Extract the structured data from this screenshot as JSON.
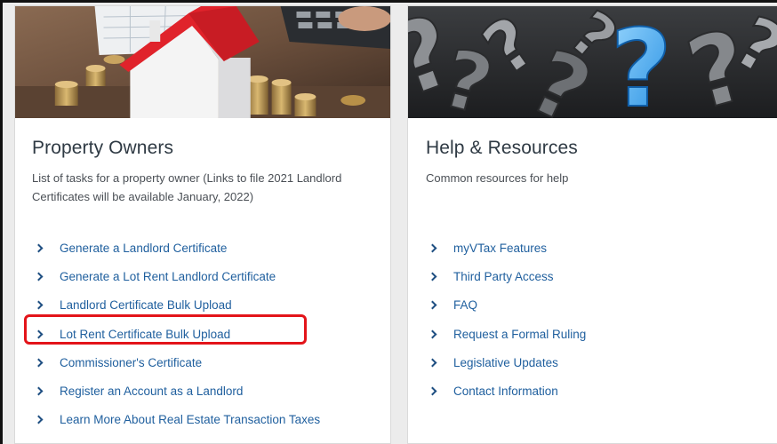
{
  "property_owners": {
    "title": "Property Owners",
    "description": "List of tasks for a property owner (Links to file 2021 Landlord Certificates will be available January, 2022)",
    "links": [
      {
        "label": "Generate a Landlord Certificate"
      },
      {
        "label": "Generate a Lot Rent Landlord Certificate"
      },
      {
        "label": "Landlord Certificate Bulk Upload"
      },
      {
        "label": "Lot Rent Certificate Bulk Upload"
      },
      {
        "label": "Commissioner's Certificate"
      },
      {
        "label": "Register an Account as a Landlord"
      },
      {
        "label": "Learn More About Real Estate Transaction Taxes"
      }
    ]
  },
  "help_resources": {
    "title": "Help & Resources",
    "description": "Common resources for help",
    "links": [
      {
        "label": "myVTax Features"
      },
      {
        "label": "Third Party Access"
      },
      {
        "label": "FAQ"
      },
      {
        "label": "Request a Formal Ruling"
      },
      {
        "label": "Legislative Updates"
      },
      {
        "label": "Contact Information"
      }
    ]
  },
  "colors": {
    "link": "#1f5f9e",
    "highlight": "#e3141a",
    "roof": "#e0232b"
  },
  "icons": {
    "link_chevron": "chevron-right-icon"
  }
}
